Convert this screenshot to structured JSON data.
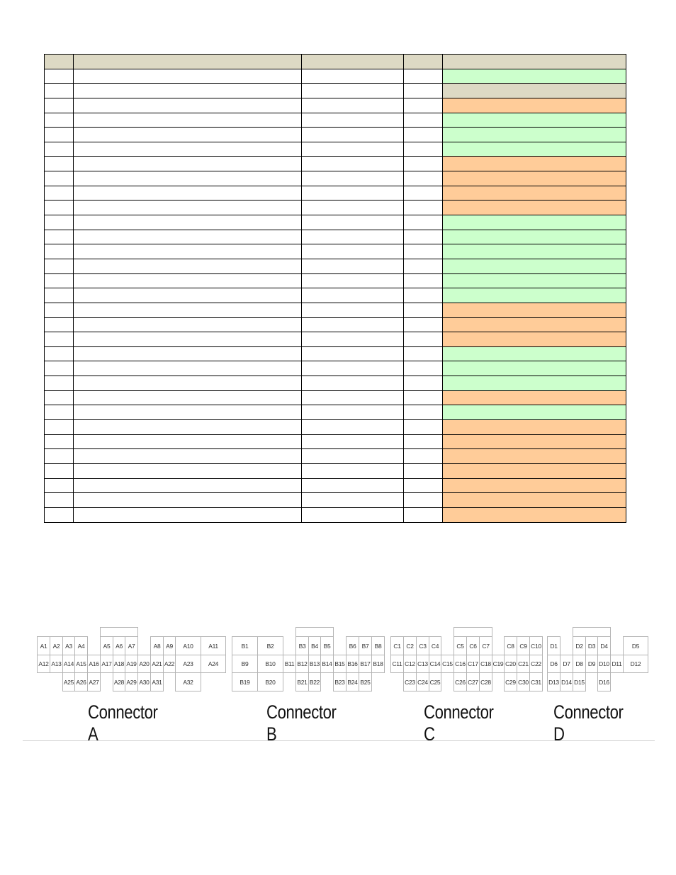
{
  "table": {
    "columns": [
      "",
      "",
      "",
      "",
      ""
    ],
    "colors": {
      "green": "#ccffcc",
      "beige": "#ddd9c4",
      "orange": "#ffcc99",
      "header": "#ddd9c4"
    },
    "rows": [
      {
        "cells": [
          "",
          "",
          "",
          ""
        ],
        "status": "green"
      },
      {
        "cells": [
          "",
          "",
          "",
          ""
        ],
        "status": "beige"
      },
      {
        "cells": [
          "",
          "",
          "",
          ""
        ],
        "status": "orange"
      },
      {
        "cells": [
          "",
          "",
          "",
          ""
        ],
        "status": "green"
      },
      {
        "cells": [
          "",
          "",
          "",
          ""
        ],
        "status": "green"
      },
      {
        "cells": [
          "",
          "",
          "",
          ""
        ],
        "status": "green"
      },
      {
        "cells": [
          "",
          "",
          "",
          ""
        ],
        "status": "orange"
      },
      {
        "cells": [
          "",
          "",
          "",
          ""
        ],
        "status": "orange"
      },
      {
        "cells": [
          "",
          "",
          "",
          ""
        ],
        "status": "orange"
      },
      {
        "cells": [
          "",
          "",
          "",
          ""
        ],
        "status": "orange"
      },
      {
        "cells": [
          "",
          "",
          "",
          ""
        ],
        "status": "green"
      },
      {
        "cells": [
          "",
          "",
          "",
          ""
        ],
        "status": "green"
      },
      {
        "cells": [
          "",
          "",
          "",
          ""
        ],
        "status": "green"
      },
      {
        "cells": [
          "",
          "",
          "",
          ""
        ],
        "status": "green"
      },
      {
        "cells": [
          "",
          "",
          "",
          ""
        ],
        "status": "green"
      },
      {
        "cells": [
          "",
          "",
          "",
          ""
        ],
        "status": "green"
      },
      {
        "cells": [
          "",
          "",
          "",
          ""
        ],
        "status": "orange"
      },
      {
        "cells": [
          "",
          "",
          "",
          ""
        ],
        "status": "orange"
      },
      {
        "cells": [
          "",
          "",
          "",
          ""
        ],
        "status": "orange"
      },
      {
        "cells": [
          "",
          "",
          "",
          ""
        ],
        "status": "green"
      },
      {
        "cells": [
          "",
          "",
          "",
          ""
        ],
        "status": "green"
      },
      {
        "cells": [
          "",
          "",
          "",
          ""
        ],
        "status": "green"
      },
      {
        "cells": [
          "",
          "",
          "",
          ""
        ],
        "status": "orange"
      },
      {
        "cells": [
          "",
          "",
          "",
          ""
        ],
        "status": "green"
      },
      {
        "cells": [
          "",
          "",
          "",
          ""
        ],
        "status": "orange"
      },
      {
        "cells": [
          "",
          "",
          "",
          ""
        ],
        "status": "orange"
      },
      {
        "cells": [
          "",
          "",
          "",
          ""
        ],
        "status": "orange"
      },
      {
        "cells": [
          "",
          "",
          "",
          ""
        ],
        "status": "orange"
      },
      {
        "cells": [
          "",
          "",
          "",
          ""
        ],
        "status": "orange"
      },
      {
        "cells": [
          "",
          "",
          "",
          ""
        ],
        "status": "orange"
      },
      {
        "cells": [
          "",
          "",
          "",
          ""
        ],
        "status": "orange"
      }
    ]
  },
  "connectors": [
    {
      "id": "a",
      "label": "Connector A",
      "rows": [
        [
          "A1",
          "A2",
          "A3",
          "A4",
          null,
          "A5",
          "A6",
          "A7",
          null,
          "A8",
          "A9",
          "A10",
          "A11"
        ],
        [
          "A12",
          "A13",
          "A14",
          "A15",
          "A16",
          "A17",
          "A18",
          "A19",
          "A20",
          "A21",
          "A22",
          "A23",
          "A24"
        ],
        [
          null,
          null,
          "A25",
          "A26",
          "A27",
          null,
          "A28",
          "A29",
          "A30",
          "A31",
          null,
          "A32",
          null
        ]
      ]
    },
    {
      "id": "b",
      "label": "Connector B",
      "rows": [
        [
          "B1",
          "B2",
          null,
          "B3",
          "B4",
          "B5",
          null,
          "B6",
          "B7",
          "B8"
        ],
        [
          "B9",
          "B10",
          "B11",
          "B12",
          "B13",
          "B14",
          "B15",
          "B16",
          "B17",
          "B18"
        ],
        [
          "B19",
          "B20",
          null,
          "B21",
          "B22",
          null,
          "B23",
          "B24",
          "B25",
          null
        ]
      ]
    },
    {
      "id": "c",
      "label": "Connector C",
      "rows": [
        [
          "C1",
          "C2",
          "C3",
          "C4",
          null,
          "C5",
          "C6",
          "C7",
          null,
          "C8",
          "C9",
          "C10"
        ],
        [
          "C11",
          "C12",
          "C13",
          "C14",
          "C15",
          "C16",
          "C17",
          "C18",
          "C19",
          "C20",
          "C21",
          "C22"
        ],
        [
          null,
          "C23",
          "C24",
          "C25",
          null,
          "C26",
          "C27",
          "C28",
          null,
          "C29",
          "C30",
          "C31"
        ]
      ]
    },
    {
      "id": "d",
      "label": "Connector D",
      "rows": [
        [
          "D1",
          null,
          "D2",
          "D3",
          "D4",
          null,
          "D5"
        ],
        [
          "D6",
          "D7",
          "D8",
          "D9",
          "D10",
          "D11",
          "D12"
        ],
        [
          "D13",
          "D14",
          "D15",
          null,
          "D16",
          null,
          null
        ]
      ]
    }
  ]
}
